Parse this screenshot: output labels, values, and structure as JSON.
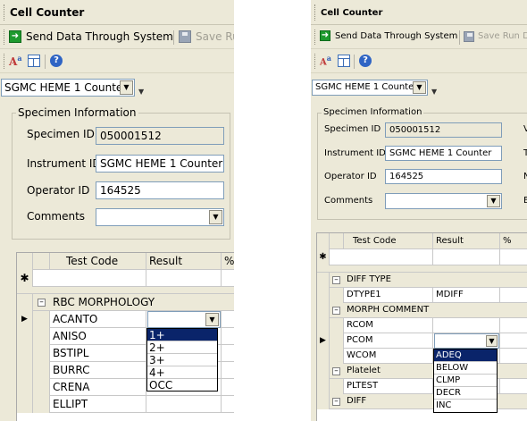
{
  "left": {
    "title": "Cell Counter",
    "toolbar": {
      "send_label": "Send Data Through System",
      "save_label": "Save Ru"
    },
    "analyzer": "SGMC HEME 1 Counter",
    "specimen": {
      "legend": "Specimen Information",
      "specimen_id_label": "Specimen ID",
      "specimen_id": "050001512",
      "instrument_id_label": "Instrument ID",
      "instrument_id": "SGMC HEME 1 Counter",
      "operator_id_label": "Operator ID",
      "operator_id": "164525",
      "comments_label": "Comments",
      "comments": ""
    },
    "grid": {
      "headers": [
        "Test Code",
        "Result",
        "%"
      ],
      "new_row_marker": "✱",
      "current_row_marker": "▶",
      "group": "RBC MORPHOLOGY",
      "rows": [
        "ACANTO",
        "ANISO",
        "BSTIPL",
        "BURRC",
        "CRENA",
        "ELLIPT"
      ],
      "dropdown_options": [
        "1+",
        "2+",
        "3+",
        "4+",
        "OCC"
      ],
      "dropdown_selected": "1+"
    }
  },
  "right": {
    "title": "Cell Counter",
    "toolbar": {
      "send_label": "Send Data Through System",
      "save_label": "Save Run D"
    },
    "analyzer": "SGMC HEME 1 Counter",
    "specimen": {
      "legend": "Specimen Information",
      "specimen_id_label": "Specimen ID",
      "specimen_id": "050001512",
      "instrument_id_label": "Instrument ID",
      "instrument_id": "SGMC HEME 1 Counter",
      "operator_id_label": "Operator ID",
      "operator_id": "164525",
      "comments_label": "Comments",
      "comments": "",
      "cut_labels": [
        "V",
        "T",
        "N",
        "E"
      ]
    },
    "grid": {
      "headers": [
        "Test Code",
        "Result",
        "%"
      ],
      "new_row_marker": "✱",
      "current_row_marker": "▶",
      "groups": [
        {
          "name": "DIFF TYPE",
          "rows": [
            {
              "code": "DTYPE1",
              "result": "MDIFF"
            }
          ]
        },
        {
          "name": "MORPH COMMENT",
          "rows": [
            {
              "code": "RCOM",
              "result": ""
            },
            {
              "code": "PCOM",
              "result": ""
            },
            {
              "code": "WCOM",
              "result": ""
            }
          ]
        },
        {
          "name": "Platelet",
          "rows": [
            {
              "code": "PLTEST",
              "result": ""
            }
          ]
        },
        {
          "name": "DIFF",
          "rows": []
        }
      ],
      "dropdown_options": [
        "ADEQ",
        "BELOW",
        "CLMP",
        "DECR",
        "INC"
      ],
      "dropdown_selected": "ADEQ"
    }
  }
}
